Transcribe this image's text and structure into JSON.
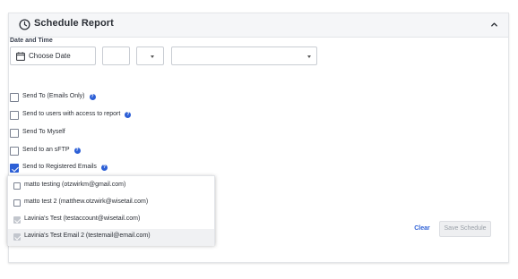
{
  "header": {
    "title": "Schedule Report"
  },
  "date_time": {
    "label": "Date and Time",
    "choose_date_label": "Choose Date",
    "hour_value": "",
    "ampm_value": "",
    "timezone_value": ""
  },
  "options": [
    {
      "label": "Send To (Emails Only)",
      "checked": false,
      "help": true
    },
    {
      "label": "Send to users with access to report",
      "checked": false,
      "help": true
    },
    {
      "label": "Send To Myself",
      "checked": false,
      "help": false
    },
    {
      "label": "Send to an sFTP",
      "checked": false,
      "help": true
    },
    {
      "label": "Send to Registered Emails",
      "checked": true,
      "help": true
    }
  ],
  "registered_emails_dropdown": [
    {
      "label": "matto testing (otzwirkm@gmail.com)",
      "checked": false
    },
    {
      "label": "matto test 2 (matthew.otzwirk@wisetail.com)",
      "checked": false
    },
    {
      "label": "Lavinia's Test (testaccount@wisetail.com)",
      "checked": true
    },
    {
      "label": "Lavinia's Test Email 2 (testemail@email.com)",
      "checked": true
    }
  ],
  "actions": {
    "clear_label": "Clear",
    "save_label": "Save Schedule"
  },
  "colors": {
    "accent": "#2c5fd6",
    "header_bg": "#f5f6f8",
    "border": "#e3e5e8"
  }
}
